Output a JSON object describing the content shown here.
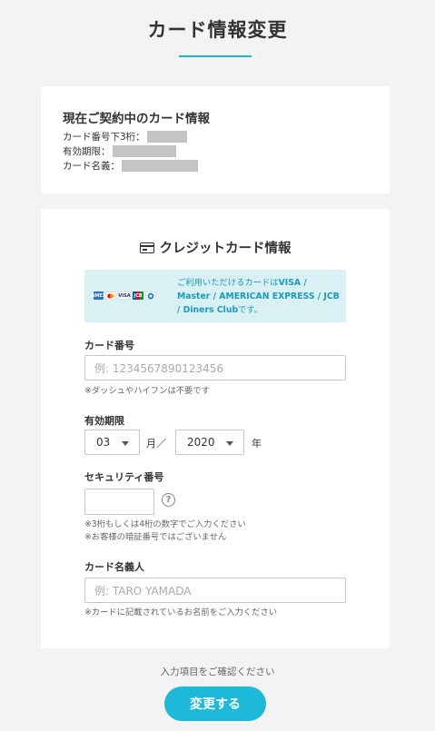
{
  "page": {
    "title": "カード情報変更"
  },
  "current_card": {
    "heading": "現在ご契約中のカード情報",
    "last3_label": "カード番号下3桁：",
    "expiry_label": "有効期限：",
    "holder_label": "カード名義："
  },
  "credit_card": {
    "heading": "クレジットカード情報",
    "brand_notice_prefix": "ご利用いただけるカードは",
    "brand_notice_brands": "VISA / Master / AMERICAN EXPRESS / JCB / Diners Club",
    "brand_notice_suffix": "です。",
    "logos": [
      "AMEX",
      "MC",
      "VISA",
      "JCB",
      "DC"
    ],
    "card_number": {
      "label": "カード番号",
      "placeholder": "例: 1234567890123456",
      "hint": "※ダッシュやハイフンは不要です"
    },
    "expiry": {
      "label": "有効期限",
      "month_value": "03",
      "month_unit": "月／",
      "year_value": "2020",
      "year_unit": "年"
    },
    "security_code": {
      "label": "セキュリティ番号",
      "help_glyph": "?",
      "hint_line1": "※3桁もしくは4桁の数字でご入力ください",
      "hint_line2": "※お客様の暗証番号ではございません"
    },
    "holder_name": {
      "label": "カード名義人",
      "placeholder": "例: TARO YAMADA",
      "hint": "※カードに記載されているお名前をご入力ください"
    }
  },
  "footer": {
    "confirm_note": "入力項目をご確認ください",
    "submit_label": "変更する"
  },
  "colors": {
    "accent": "#1cb9d8",
    "notice_bg": "#d9f0f5",
    "notice_text": "#1a9bba"
  }
}
